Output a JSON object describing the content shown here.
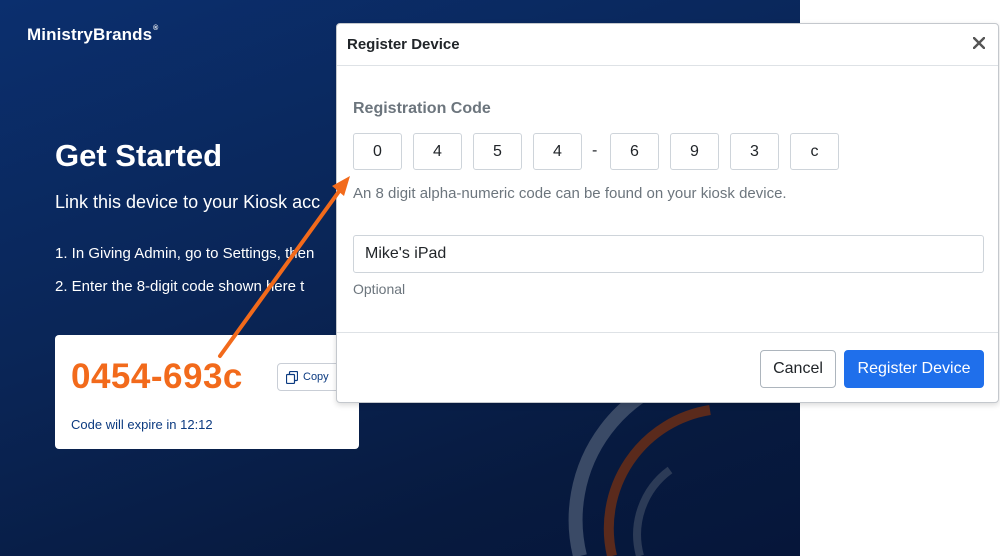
{
  "background": {
    "brand": "MinistryBrands",
    "brand_mark": "®",
    "headline": "Get Started",
    "subline": "Link this device to your Kiosk acc",
    "steps": [
      "1.  In Giving Admin, go to Settings, then",
      "2.  Enter the 8-digit code shown here t"
    ],
    "code_card": {
      "code": "0454-693c",
      "copy_label": "Copy",
      "expire_text": "Code will expire in 12:12"
    }
  },
  "modal": {
    "title": "Register Device",
    "registration_label": "Registration Code",
    "code_chars": [
      "0",
      "4",
      "5",
      "4",
      "6",
      "9",
      "3",
      "c"
    ],
    "separator": "-",
    "hint": "An 8 digit alpha-numeric code can be found on your kiosk device.",
    "device_name_value": "Mike's iPad",
    "optional_label": "Optional",
    "cancel_label": "Cancel",
    "register_label": "Register Device"
  },
  "colors": {
    "navy": "#0a2556",
    "orange": "#f26a1b",
    "primary": "#1f6feb"
  },
  "icons": {
    "copy": "copy-icon",
    "close": "close-icon"
  }
}
